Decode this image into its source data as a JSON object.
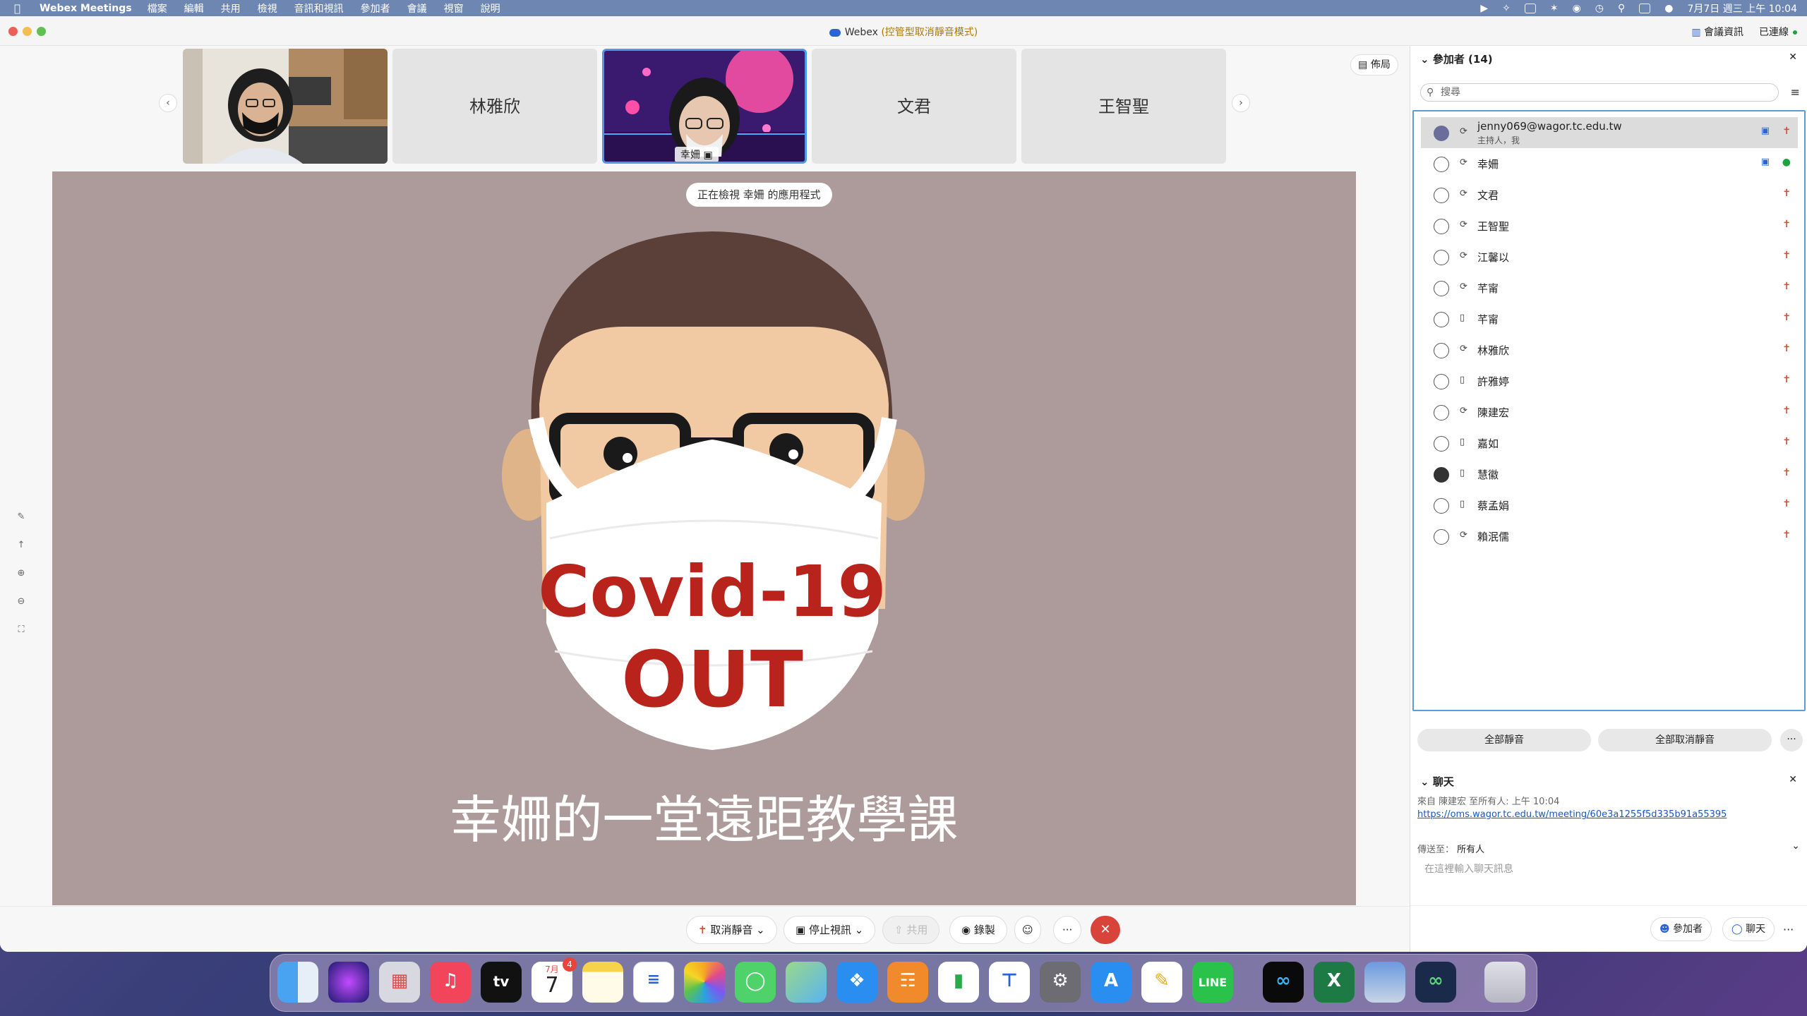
{
  "menubar": {
    "app_name": "Webex Meetings",
    "items": [
      "檔案",
      "編輯",
      "共用",
      "檢視",
      "音訊和視訊",
      "參加者",
      "會議",
      "視窗",
      "說明"
    ],
    "clock": "7月7日 週三 上午 10:04"
  },
  "window": {
    "title": "Webex",
    "title_mode": "(控管型取消靜音模式)",
    "meeting_info": "會議資訊",
    "connected": "已連線"
  },
  "filmstrip": {
    "tiles": [
      {
        "name": ""
      },
      {
        "name": "林雅欣"
      },
      {
        "name": "幸姍"
      },
      {
        "name": "文君"
      },
      {
        "name": "王智聖"
      }
    ],
    "layout_label": "佈局"
  },
  "share": {
    "viewing_label": "正在檢視 幸姍 的應用程式",
    "mask_line1": "Covid-19",
    "mask_line2": "OUT",
    "caption": "幸姍的一堂遠距教學課"
  },
  "controls": {
    "unmute": "取消靜音",
    "stop_video": "停止視訊",
    "share": "共用",
    "record": "錄製",
    "more": "···"
  },
  "participants": {
    "header": "參加者 (14)",
    "search_placeholder": "搜尋",
    "list": [
      {
        "name": "jenny069@wagor.tc.edu.tw",
        "sub": "主持人，我"
      },
      {
        "name": "幸姍"
      },
      {
        "name": "文君"
      },
      {
        "name": "王智聖"
      },
      {
        "name": "江馨以"
      },
      {
        "name": "芊甯"
      },
      {
        "name": "芊甯"
      },
      {
        "name": "林雅欣"
      },
      {
        "name": "許雅婷"
      },
      {
        "name": "陳建宏"
      },
      {
        "name": "嘉如"
      },
      {
        "name": "慧徽"
      },
      {
        "name": "蔡孟娟"
      },
      {
        "name": "賴泯儒"
      }
    ],
    "mute_all": "全部靜音",
    "unmute_all": "全部取消靜音"
  },
  "chat": {
    "header": "聊天",
    "meta": "來自 陳建宏 至所有人:   上午 10:04",
    "link": "https://oms.wagor.tc.edu.tw/meeting/60e3a1255f5d335b91a55395",
    "send_to_label": "傳送至：",
    "send_to_value": "所有人",
    "placeholder": "在這裡輸入聊天訊息"
  },
  "panel_bar": {
    "participants": "參加者",
    "chat": "聊天"
  },
  "dock": {
    "calendar_month": "7月",
    "calendar_day": "7",
    "calendar_badge": "4"
  },
  "colors": {
    "menubar": "#6d86b2",
    "share_bg": "#ad9b9b",
    "mask_text": "#b8231c",
    "selection_border": "#5a9bd8",
    "end_button": "#d8433a"
  }
}
